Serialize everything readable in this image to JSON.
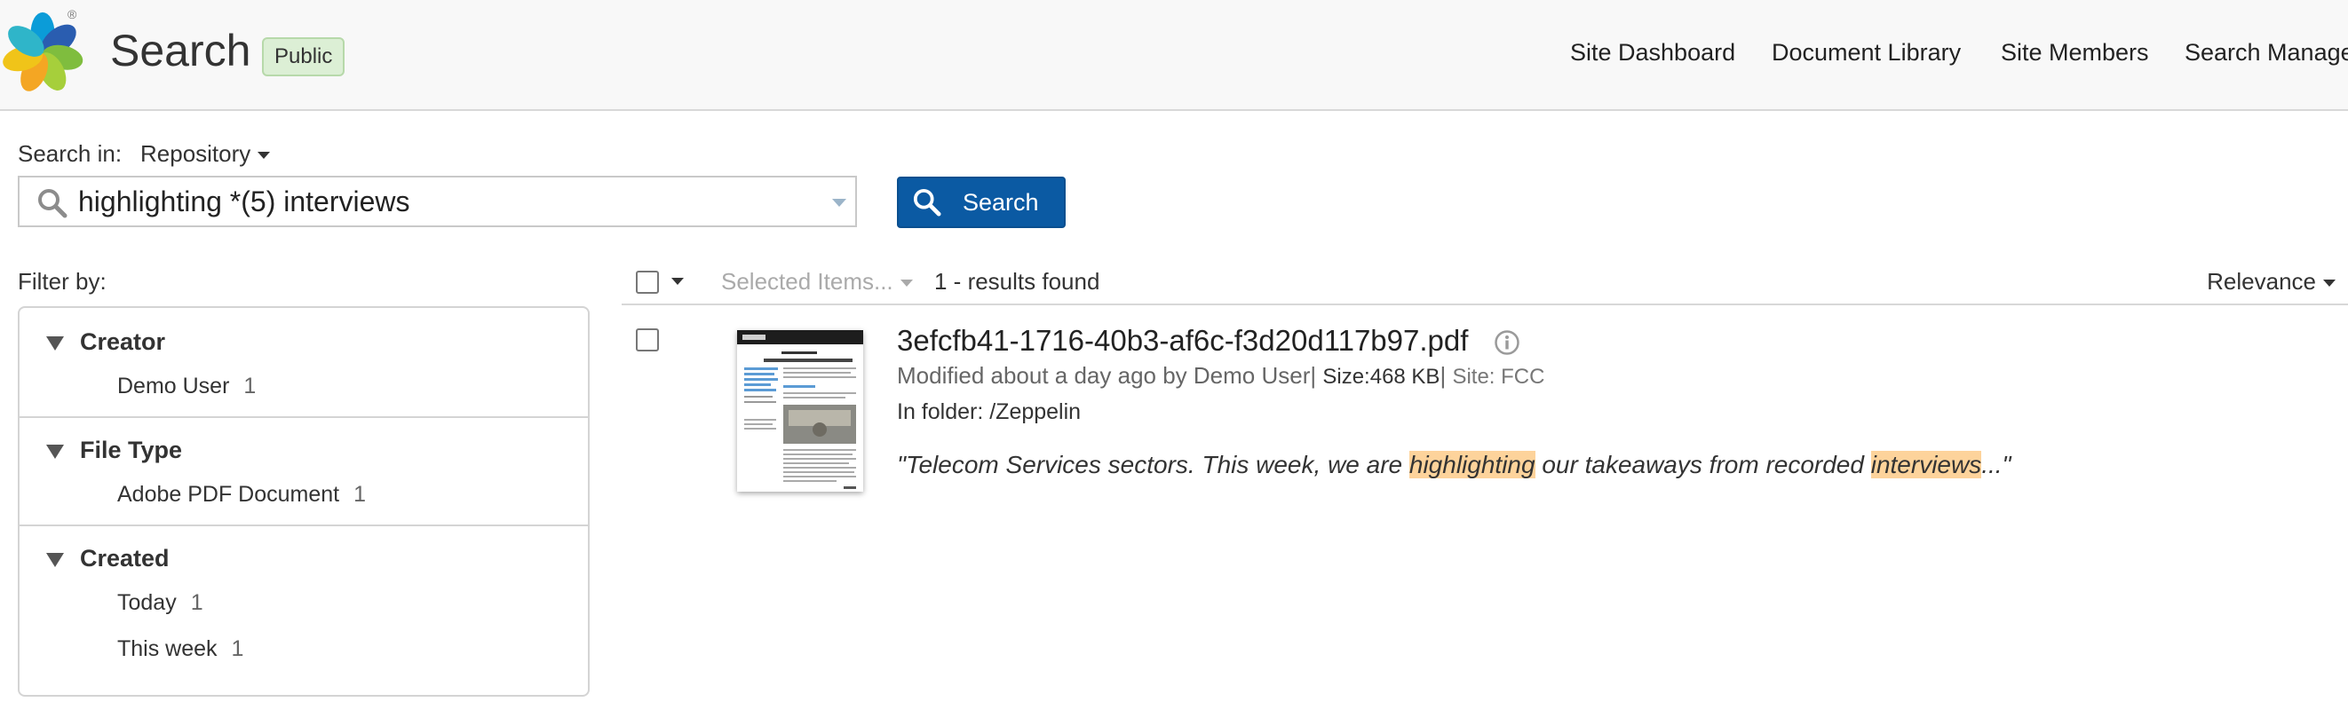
{
  "header": {
    "title": "Search",
    "badge": "Public",
    "registered_mark": "®",
    "nav": [
      "Site Dashboard",
      "Document Library",
      "Site Members",
      "Search Manage"
    ]
  },
  "search": {
    "scope_label": "Search in:",
    "scope_value": "Repository",
    "query": "highlighting *(5) interviews",
    "button_label": "Search"
  },
  "filters": {
    "label": "Filter by:",
    "facets": [
      {
        "name": "Creator",
        "items": [
          {
            "label": "Demo User",
            "count": "1"
          }
        ]
      },
      {
        "name": "File Type",
        "items": [
          {
            "label": "Adobe PDF Document",
            "count": "1"
          }
        ]
      },
      {
        "name": "Created",
        "items": [
          {
            "label": "Today",
            "count": "1"
          },
          {
            "label": "This week",
            "count": "1"
          }
        ]
      }
    ]
  },
  "results_toolbar": {
    "selected_items": "Selected Items...",
    "count_text": "1 - results found",
    "sort": "Relevance"
  },
  "result": {
    "title": "3efcfb41-1716-40b3-af6c-f3d20d117b97.pdf",
    "modified": "Modified about a day ago by Demo User",
    "size": "Size:468 KB",
    "site": "Site: FCC",
    "folder": "In folder: /Zeppelin",
    "snippet_parts": [
      "\"Telecom Services sectors. This week, we are ",
      "highlighting",
      " our takeaways from recorded ",
      "interviews",
      "...\""
    ]
  },
  "colors": {
    "primary_button": "#0b5aa3",
    "badge_bg": "#dcefd5",
    "highlight": "#fdd39b"
  }
}
